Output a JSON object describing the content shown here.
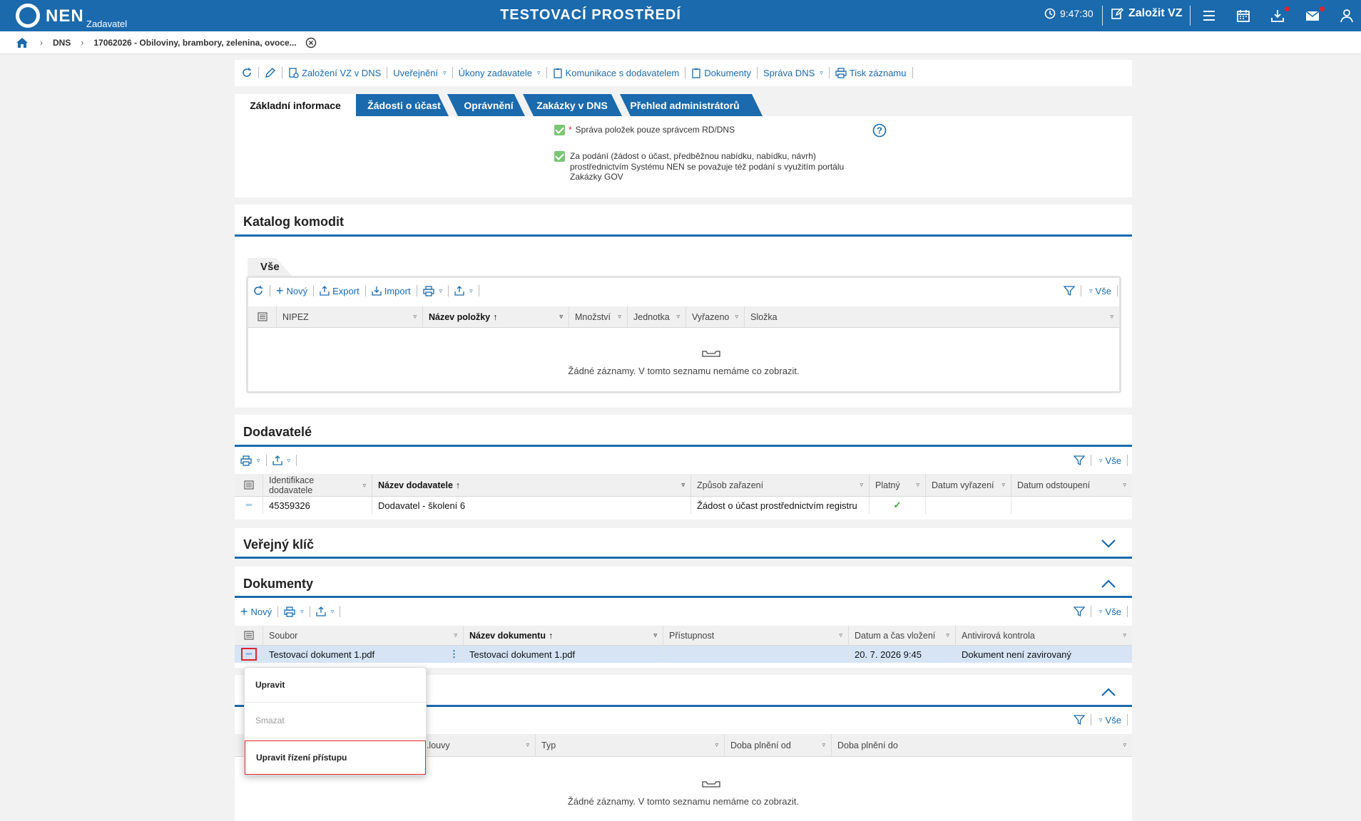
{
  "header": {
    "brand": "NEN",
    "role": "Zadavatel",
    "env_title": "TESTOVACÍ PROSTŘEDÍ",
    "time": "9:47:30",
    "new_vz": "Založit VZ"
  },
  "breadcrumb": {
    "level1": "DNS",
    "level2": "17062026 - Obiloviny, brambory, zelenina, ovoce..."
  },
  "toolbar": {
    "founding": "Založení VZ v DNS",
    "publishing": "Uveřejnění",
    "acts": "Úkony zadavatele",
    "communication": "Komunikace s dodavatelem",
    "documents": "Dokumenty",
    "dns_admin": "Správa DNS",
    "print": "Tisk záznamu"
  },
  "tabs": [
    "Základní informace",
    "Žádosti o účast",
    "Oprávnění",
    "Zakázky v DNS",
    "Přehled administrátorů"
  ],
  "basic": {
    "required_mark": "*",
    "item_management": "Správa položek pouze správcem RD/DNS",
    "submission_note": "Za podání (žádost o účast, předběžnou nabídku, nabídku, návrh) prostřednictvím Systému NEN se považuje též podání s využitím portálu Zakázky GOV"
  },
  "catalog": {
    "title": "Katalog komodit",
    "subtab": "Vše",
    "new": "Nový",
    "export": "Export",
    "import": "Import",
    "filter_all": "Vše",
    "columns": [
      "NIPEZ",
      "Název položky",
      "Množství",
      "Jednotka",
      "Vyřazeno",
      "Složka"
    ],
    "empty": "Žádné záznamy. V tomto seznamu nemáme co zobrazit."
  },
  "suppliers": {
    "title": "Dodavatelé",
    "filter_all": "Vše",
    "columns": [
      "Identifikace dodavatele",
      "Název dodavatele",
      "Způsob zařazení",
      "Platný",
      "Datum vyřazení",
      "Datum odstoupení"
    ],
    "rows": [
      {
        "id": "45359326",
        "name": "Dodavatel - školení 6",
        "method": "Žádost o účast prostřednictvím registru",
        "valid": "✓",
        "excluded": "",
        "withdrawn": ""
      }
    ]
  },
  "public_key": {
    "title": "Veřejný klíč"
  },
  "documents": {
    "title": "Dokumenty",
    "new": "Nový",
    "filter_all": "Vše",
    "columns": [
      "Soubor",
      "Název dokumentu",
      "Přístupnost",
      "Datum a čas vložení",
      "Antivirová kontrola"
    ],
    "rows": [
      {
        "file": "Testovací dokument 1.pdf",
        "name": "Testovací dokument 1.pdf",
        "access": "",
        "inserted": "20. 7. 2026 9:45",
        "antivirus": "Dokument není zavirovaný"
      }
    ]
  },
  "contracts": {
    "filter_all": "Vše",
    "columns": [
      "...louvy",
      "Typ",
      "Doba plnění od",
      "Doba plnění do"
    ],
    "empty": "Žádné záznamy. V tomto seznamu nemáme co zobrazit."
  },
  "context_menu": {
    "items": [
      "Upravit",
      "Smazat",
      "Upravit řízení přístupu"
    ]
  },
  "icons": {
    "home": "home-icon",
    "clock": "clock-icon",
    "menu": "hamburger-icon",
    "calendar": "calendar-icon",
    "download": "download-icon",
    "mail": "mail-icon",
    "user": "user-icon",
    "filter": "filter-icon",
    "refresh": "refresh-icon",
    "print": "print-icon",
    "export": "export-icon"
  },
  "colors": {
    "primary": "#1a6aad",
    "header_bg": "#1a6aad",
    "check_green": "#7cc576",
    "notification_red": "#e0242d",
    "selected_row": "#d6e4f6",
    "highlight_border": "#e0242d"
  }
}
